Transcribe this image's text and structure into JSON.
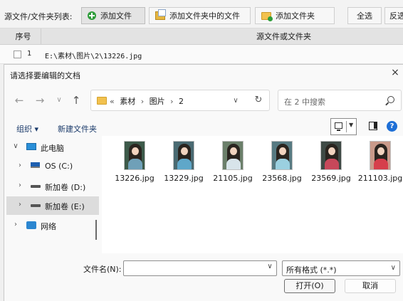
{
  "app": {
    "list_label": "源文件/文件夹列表:",
    "buttons": {
      "add_file": "添加文件",
      "add_folder_files": "添加文件夹中的文件",
      "add_folder": "添加文件夹",
      "select_all": "全选",
      "invert": "反选"
    },
    "table": {
      "col_num": "序号",
      "col_source": "源文件或文件夹",
      "rows": [
        {
          "num": "1",
          "path": "E:\\素材\\图片\\2\\13226.jpg"
        }
      ]
    }
  },
  "dialog": {
    "title": "请选择要编辑的文档",
    "close": "×",
    "nav": {
      "back": "←",
      "forward": "→",
      "history": "∨",
      "up": "↑"
    },
    "address": {
      "crumbs": [
        "«",
        "素材",
        "›",
        "图片",
        "›",
        "2"
      ],
      "dropdown": "∨",
      "refresh": "↻"
    },
    "search": {
      "placeholder": "在 2 中搜索"
    },
    "commands": {
      "organize": "组织 ▾",
      "new_folder": "新建文件夹"
    },
    "help": "?",
    "tree": [
      {
        "chevron": "∨",
        "label": "此电脑",
        "icon": "pc-icon"
      },
      {
        "chevron": "›",
        "label": "OS (C:)",
        "icon": "os-drive-icon"
      },
      {
        "chevron": "›",
        "label": "新加卷 (D:)",
        "icon": "drive-icon"
      },
      {
        "chevron": "›",
        "label": "新加卷 (E:)",
        "icon": "drive-icon",
        "selected": true
      },
      {
        "chevron": "›",
        "label": "网络",
        "icon": "network-icon"
      }
    ],
    "files": [
      {
        "name": "13226.jpg",
        "bg": "#3d5a4a",
        "dress": "#6fa0b8"
      },
      {
        "name": "13229.jpg",
        "bg": "#4a6a72",
        "dress": "#5fa7c9"
      },
      {
        "name": "21105.jpg",
        "bg": "#6b7f6a",
        "dress": "#d8e4ea"
      },
      {
        "name": "23568.jpg",
        "bg": "#577a82",
        "dress": "#9bd0e0"
      },
      {
        "name": "23569.jpg",
        "bg": "#3f4a45",
        "dress": "#c7485a"
      },
      {
        "name": "211103.jpg",
        "bg": "#c99a8a",
        "dress": "#d63f4b"
      }
    ],
    "filename_label": "文件名(N):",
    "filename_value": "",
    "filetype": "所有格式 (*.*)",
    "open_button": "打开(O)",
    "cancel_button": "取消"
  }
}
